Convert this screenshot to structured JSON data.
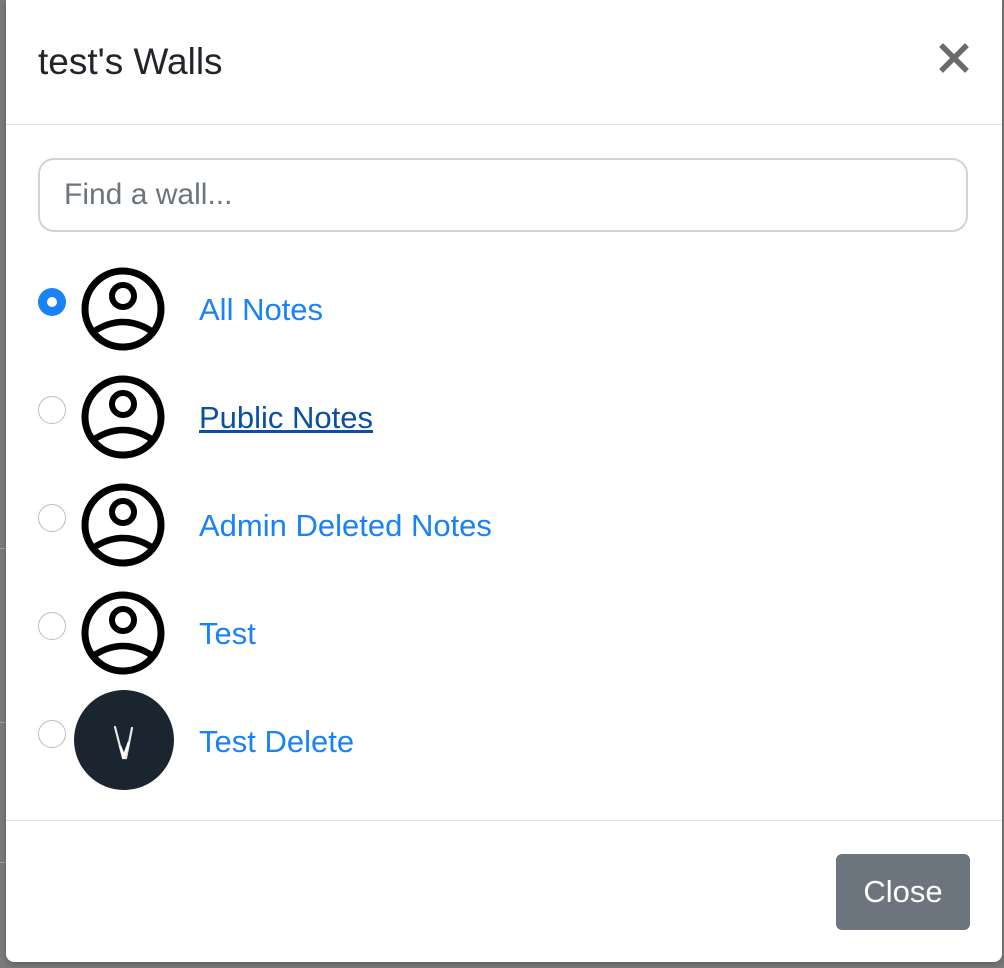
{
  "modal": {
    "title": "test's Walls",
    "close_icon": "close-icon",
    "search": {
      "placeholder": "Find a wall...",
      "value": ""
    },
    "walls": [
      {
        "label": "All Notes",
        "selected": true,
        "avatar": "user-circle-icon"
      },
      {
        "label": "Public Notes",
        "selected": false,
        "avatar": "user-circle-icon",
        "hovered": true
      },
      {
        "label": "Admin Deleted Notes",
        "selected": false,
        "avatar": "user-circle-icon"
      },
      {
        "label": "Test",
        "selected": false,
        "avatar": "user-circle-icon"
      },
      {
        "label": "Test Delete",
        "selected": false,
        "avatar": "wall-image"
      }
    ],
    "footer": {
      "close_label": "Close"
    }
  },
  "colors": {
    "link": "#1a82f7",
    "link_hover": "#0a4fa3",
    "radio_checked": "#1a82f7",
    "button_secondary": "#6c757d"
  }
}
